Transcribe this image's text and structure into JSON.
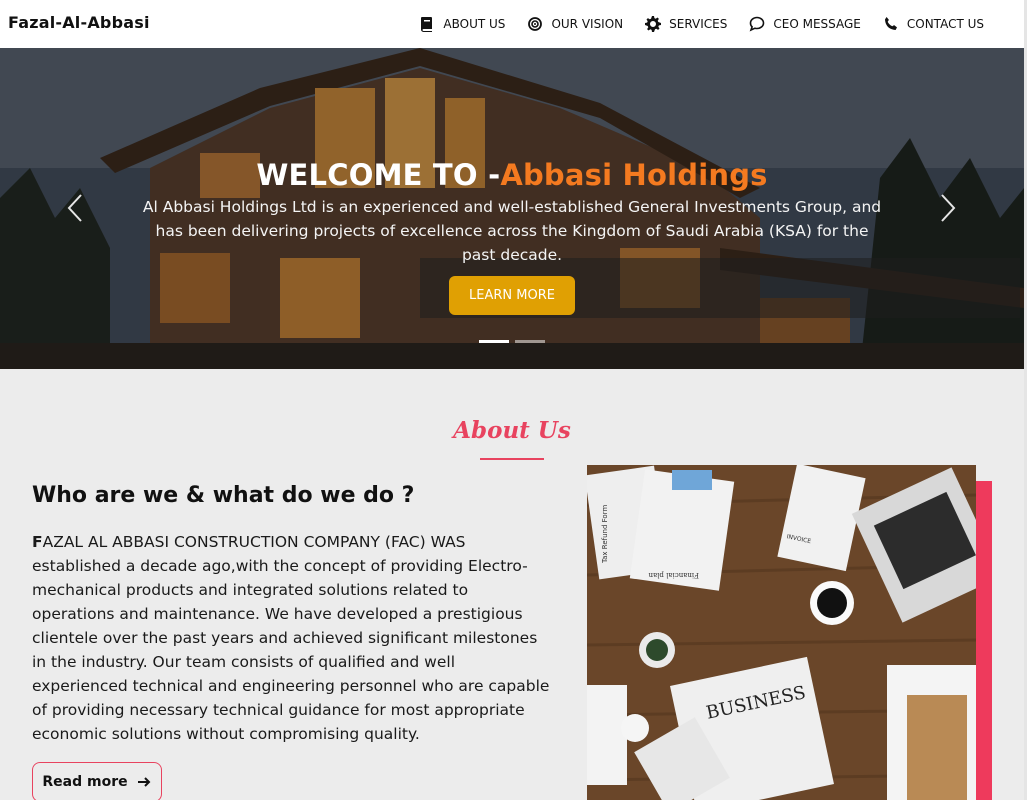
{
  "brand": "Fazal-Al-Abbasi",
  "nav": [
    {
      "label": "ABOUT US",
      "icon": "book-icon"
    },
    {
      "label": "OUR VISION",
      "icon": "target-icon"
    },
    {
      "label": "SERVICES",
      "icon": "gear-icon"
    },
    {
      "label": "CEO MESSAGE",
      "icon": "chat-bubble-icon"
    },
    {
      "label": "CONTACT US",
      "icon": "phone-icon"
    }
  ],
  "hero": {
    "title_prefix": "WELCOME TO -",
    "title_accent": "Abbasi Holdings",
    "text": "Al Abbasi Holdings Ltd is an experienced and well-established General Investments Group, and has been delivering projects of excellence across the Kingdom of Saudi Arabia (KSA) for the past decade.",
    "button_label": "LEARN MORE",
    "slide_count": 2,
    "active_slide": 1
  },
  "about": {
    "heading": "About Us",
    "subheading": "Who are we & what do we do ?",
    "body_first_letter": "F",
    "body_rest": "AZAL AL ABBASI CONSTRUCTION COMPANY (FAC) WAS established a decade ago,with the concept of providing Electro-mechanical products and integrated solutions related to operations and maintenance. We have developed a prestigious clientele over the past years and achieved significant milestones in the industry. Our team consists of qualified and well experienced technical and engineering personnel who are capable of providing necessary technical guidance for most appropriate economic solutions without compromising quality.",
    "read_more_label": "Read more",
    "photo_texts": [
      "Tax Refund Form",
      "Financial plan",
      "BUSINESS",
      "INVOICE"
    ]
  },
  "colors": {
    "accent_orange": "#f47a20",
    "button_gold": "#e0a003",
    "accent_pink": "#e8435f",
    "accent_bar": "#ee3a5c"
  }
}
